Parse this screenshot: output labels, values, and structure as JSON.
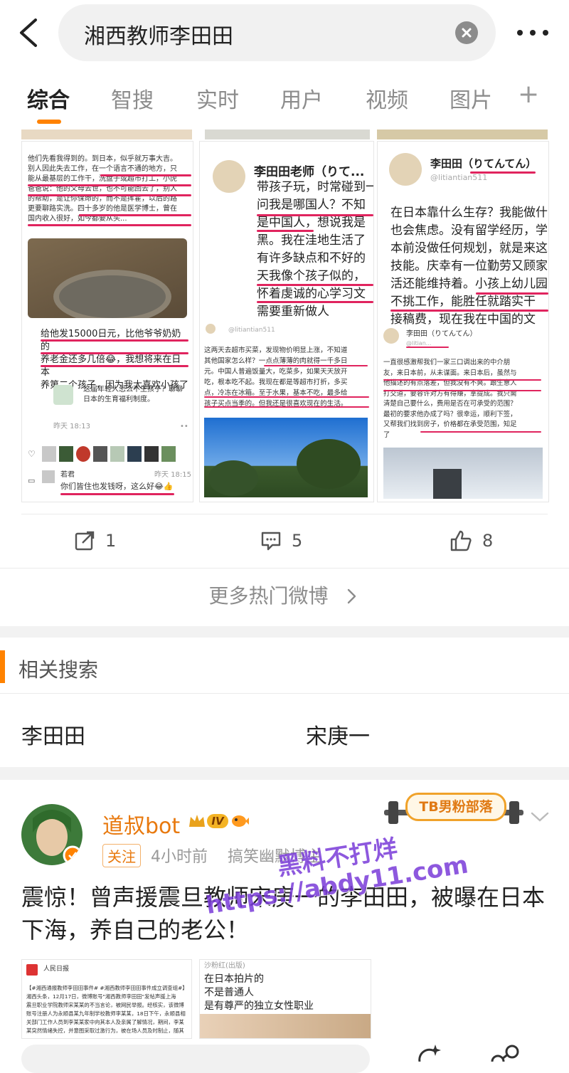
{
  "search": {
    "query": "湘西教师李田田"
  },
  "tabs": [
    "综合",
    "智搜",
    "实时",
    "用户",
    "视频",
    "图片"
  ],
  "tab_plus": "+",
  "images": {
    "img1": {
      "top_text": [
        "他们先看我得到的。到日本，似乎就万事大吉。",
        "别人因此失去工作，在一个语言不通的地方，只",
        "能从最基层的工作干，洗盘子或超市打工，小虎",
        "爸爸说：他的父母去世，也不可能回去了，别人",
        "的帮助，是让你保命的，而不是挥霍，以后的路",
        "更要聊路实洗。四十多岁的他是医学博士，曾在",
        "国内收入很好，如今都要从头..."
      ],
      "chat_lines": [
        "给他发15000日元，比他爷爷奶奶的",
        "养老金还多几倍😂，我想将来在日本",
        "养第二个孩子，因为我太喜欢小孩了"
      ],
      "link_text": [
        "这届年轻人怎么不生孩子？聊聊",
        "日本的生育福利制度。"
      ],
      "time1": "昨天 18:13",
      "comment_name": "若君",
      "comment_time": "昨天 18:15",
      "comment_text": "你们皆住也发钱呀，这么好😂👍"
    },
    "img2": {
      "name": "李田田老师（りて...",
      "lines": [
        "带孩子玩，时常碰到一",
        "问我是哪国人？不知",
        "是中国人，想说我是",
        "黑。我在洼地生活了",
        "有许多缺点和不好的",
        "天我像个孩子似的，",
        "怀着虔诚的心学习文",
        "需要重新做人"
      ],
      "handle": "@litiantian511",
      "lower": [
        "这两天去超市买菜，发现物价明显上涨，不知道",
        "其他国家怎么样？一点点薄薄的肉就得一千多日",
        "元。中国人普遍饭量大，吃菜多，如果天天放开",
        "吃，根本吃不起。我现在都是等超市打折，多买",
        "点，冷冻在冰箱。至于水果，基本不吃，最多给",
        "孩子买点当季的。但我还是很喜欢现在的生活。"
      ]
    },
    "img3": {
      "name": "李田田（りてんてん）",
      "handle": "@litiantian511",
      "lines": [
        "在日本靠什么生存？我能做什",
        "也会焦虑。没有留学经历，学",
        "本前没做任何规划，就是来这",
        "技能。庆幸有一位勤劳又顾家",
        "活还能维持着。小孩上幼儿园",
        "不挑工作，能胜任就踏实干",
        "接稿费，现在我在中国的文"
      ],
      "name2": "李田田（りてんてん）",
      "handle2": "@litian...",
      "lower": [
        "一直很感激帮我们一家三口调出来的中介朋",
        "友，来日本前，从未谋面。来日本后，虽然与",
        "他描述的有点落差，但我没有不爽。跟生意人",
        "打交道，要容许对方有得赚，拿提成。我只需",
        "清楚自己要什么，费用是否在可承受的范围？",
        "最初的要求他办成了吗？很幸运，顺利下签，",
        "又帮我们找到房子，价格都在承受范围，知足",
        "了"
      ]
    }
  },
  "actions": {
    "share_count": "1",
    "comment_count": "5",
    "like_count": "8"
  },
  "more_hot": "更多热门微博",
  "related": {
    "title": "相关搜索",
    "items": [
      "李田田",
      "宋庚一"
    ]
  },
  "post": {
    "author": "道叔bot",
    "level": "IV",
    "follow": "关注",
    "time": "4小时前",
    "category": "搞笑幽默博主",
    "sticker": "TB男粉部落",
    "text": "震惊！曾声援震旦教师宋庚一的李田田，被曝在日本下海，养自己的老公！",
    "watermark_line1": "黑料不打烊",
    "watermark_line2": "https://abdy11.com",
    "thumb1_source": "人民日报",
    "thumb1_lines": [
      "【#湘西通报教师李田田事件# #湘西教师李田田事件成立调查组#】",
      "湘西头条，12月17日，微博账号\"湘西教师李田田\"发帖声援上海",
      "震旦职业学院教师宋某某的不当言论，被网民举报。经核实，该微博",
      "账号注册人为永顺县某九年制学校教师李某某，18日下午，永顺县相",
      "关部门工作人员到李某某家中向其本人及亲属了解情况，期间，李某",
      "某突然情绪失控，并意图采取过激行为，被在场人员及时制止，随其"
    ],
    "thumb2_lines": [
      "在日本拍片的",
      "不是普通人",
      "是有尊严的独立女性职业"
    ],
    "thumb2_top": "沙粉红(出版)"
  },
  "colors": {
    "accent": "#ff8200",
    "underline": "#e0245e",
    "author": "#e8790e",
    "watermark": "#7a3bd9"
  }
}
